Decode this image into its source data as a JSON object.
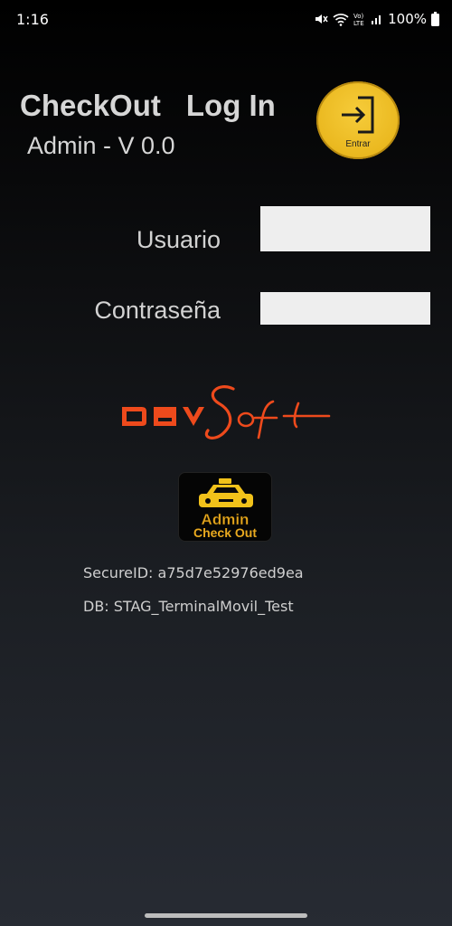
{
  "status_bar": {
    "time": "1:16",
    "battery": "100%",
    "icons": [
      "mute-icon",
      "wifi-icon",
      "volte-icon",
      "signal-icon",
      "battery-icon"
    ]
  },
  "header": {
    "app_name": "CheckOut",
    "screen_name": "Log In",
    "subtitle": "Admin - V 0.0",
    "enter_button_label": "Entrar"
  },
  "form": {
    "user_label": "Usuario",
    "user_value": "",
    "password_label": "Contraseña",
    "password_value": ""
  },
  "branding": {
    "logo_text": "DavSoft",
    "app_icon_line1": "Admin",
    "app_icon_line2": "Check Out"
  },
  "info": {
    "secure_id": "SecureID: a75d7e52976ed9ea",
    "db": "DB: STAG_TerminalMovil_Test"
  },
  "colors": {
    "accent_yellow": "#eab81f",
    "logo_orange": "#ee4a1c",
    "input_bg": "#eeeeee"
  }
}
